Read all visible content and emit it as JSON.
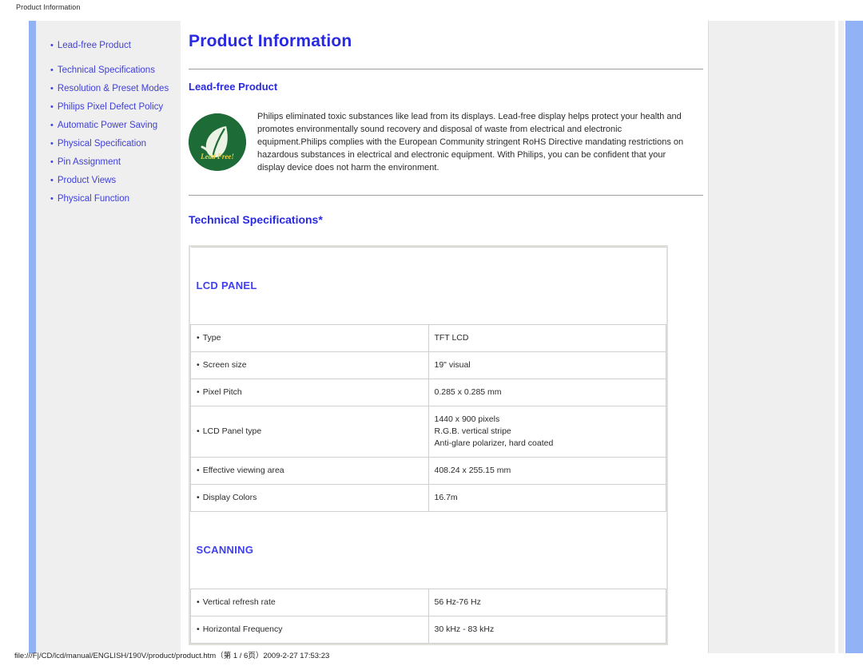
{
  "print_header": "Product Information",
  "sidebar": {
    "items": [
      {
        "label": "Lead-free Product"
      },
      {
        "label": "Technical Specifications"
      },
      {
        "label": "Resolution & Preset Modes"
      },
      {
        "label": "Philips Pixel Defect Policy"
      },
      {
        "label": "Automatic Power Saving"
      },
      {
        "label": "Physical Specification"
      },
      {
        "label": "Pin Assignment"
      },
      {
        "label": "Product Views"
      },
      {
        "label": "Physical Function"
      }
    ],
    "bullet": "•"
  },
  "main": {
    "title": "Product Information",
    "lead_free": {
      "heading": "Lead-free Product",
      "logo_caption": "Lead Free!",
      "paragraph": "Philips eliminated toxic substances like lead from its displays. Lead-free display helps protect your health and promotes environmentally sound recovery and disposal of waste from electrical and electronic equipment.Philips complies with the European Community stringent RoHS Directive mandating restrictions on hazardous substances in electrical and electronic equipment. With Philips, you can be confident that your display device does not harm the environment."
    },
    "tech_specs": {
      "heading": "Technical Specifications*",
      "groups": [
        {
          "name": "LCD PANEL",
          "rows": [
            {
              "label": "Type",
              "values": [
                "TFT LCD"
              ]
            },
            {
              "label": "Screen size",
              "values": [
                "19\" visual"
              ]
            },
            {
              "label": "Pixel Pitch",
              "values": [
                "0.285 x 0.285 mm"
              ]
            },
            {
              "label": "LCD Panel type",
              "values": [
                "1440 x 900 pixels",
                "R.G.B. vertical stripe",
                "Anti-glare polarizer, hard coated"
              ]
            },
            {
              "label": "Effective viewing area",
              "values": [
                "408.24 x 255.15 mm"
              ]
            },
            {
              "label": "Display Colors",
              "values": [
                "16.7m"
              ]
            }
          ]
        },
        {
          "name": "SCANNING",
          "rows": [
            {
              "label": "Vertical refresh rate",
              "values": [
                "56 Hz-76 Hz"
              ]
            },
            {
              "label": "Horizontal Frequency",
              "values": [
                "30 kHz - 83 kHz"
              ]
            }
          ]
        }
      ]
    }
  },
  "footer": {
    "text": "file:///F|/CD/lcd/manual/ENGLISH/190V/product/product.htm（第 1 / 6页）2009-2-27 17:53:23"
  },
  "colors": {
    "link_blue": "#3f3fd8",
    "title_blue": "#2929e0",
    "rail_blue": "#92b2f6",
    "panel_gray": "#efefef",
    "logo_green": "#1d6b36",
    "logo_yellow": "#e8d54a"
  }
}
